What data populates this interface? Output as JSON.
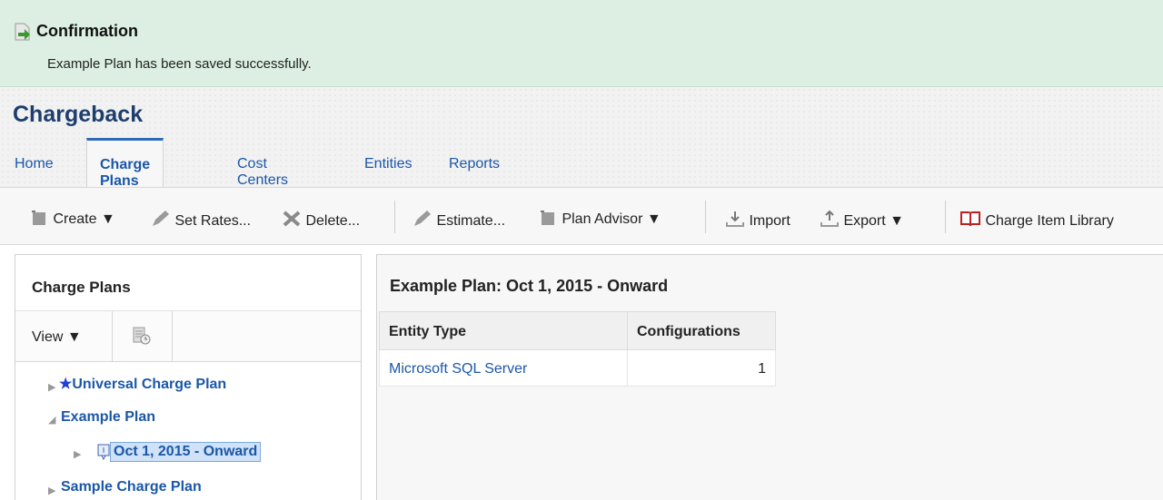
{
  "banner": {
    "title": "Confirmation",
    "message": "Example Plan has been saved successfully."
  },
  "app": {
    "title": "Chargeback"
  },
  "tabs": [
    {
      "label": "Home",
      "active": false
    },
    {
      "label": "Charge Plans",
      "active": true
    },
    {
      "label": "Cost Centers",
      "active": false
    },
    {
      "label": "Entities",
      "active": false
    },
    {
      "label": "Reports",
      "active": false
    }
  ],
  "toolbar": {
    "create": "Create",
    "set_rates": "Set Rates...",
    "delete": "Delete...",
    "estimate": "Estimate...",
    "plan_advisor": "Plan Advisor",
    "import": "Import",
    "export": "Export",
    "charge_item_library": "Charge Item Library"
  },
  "left_panel": {
    "title": "Charge Plans",
    "view_label": "View",
    "tree": [
      {
        "label": "Universal Charge Plan",
        "expanded": false,
        "starred": true
      },
      {
        "label": "Example Plan",
        "expanded": true
      },
      {
        "label": "Oct 1, 2015 - Onward",
        "selected": true
      },
      {
        "label": "Sample Charge Plan",
        "expanded": false
      }
    ]
  },
  "right_panel": {
    "title": "Example Plan: Oct 1, 2015 - Onward",
    "columns": [
      "Entity Type",
      "Configurations"
    ],
    "rows": [
      {
        "entity_type": "Microsoft SQL Server",
        "configurations": "1"
      }
    ]
  },
  "colors": {
    "banner_bg": "#dcefe2",
    "link": "#1a57a8",
    "title": "#1e3e6e",
    "selection": "#cfe2f7"
  }
}
